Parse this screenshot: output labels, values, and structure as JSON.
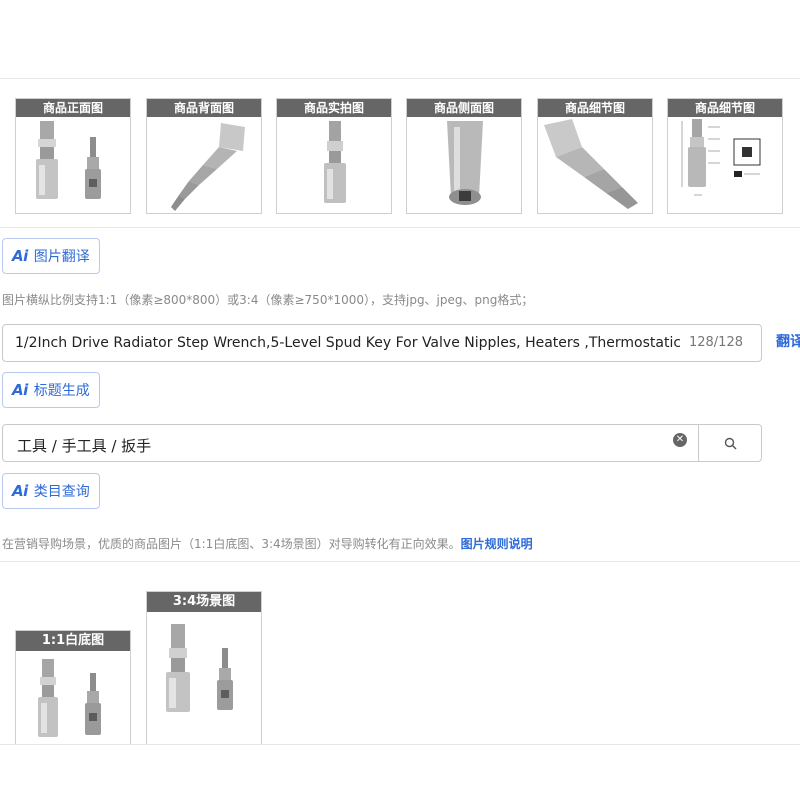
{
  "gallery": {
    "captions": [
      "商品正面图",
      "商品背面图",
      "商品实拍图",
      "商品侧面图",
      "商品细节图",
      "商品细节图"
    ]
  },
  "buttons": {
    "image_translate": "图片翻译",
    "title_generate": "标题生成",
    "category_query": "类目查询",
    "ai_icon_text": "Ai"
  },
  "image_hint": "图片横纵比例支持1:1（像素≥800*800）或3:4（像素≥750*1000），支持jpg、jpeg、png格式；",
  "title_field": {
    "value": "1/2Inch Drive Radiator Step Wrench,5-Level Spud Key For Valve Nipples, Heaters ,Thermostatic",
    "count": "128/128",
    "translate_label": "翻译"
  },
  "category_field": {
    "value": "工具 / 手工具 / 扳手"
  },
  "marketing": {
    "hint": "在营销导购场景，优质的商品图片（1:1白底图、3:4场景图）对导购转化有正向效果。",
    "rule_link": "图片规则说明"
  },
  "marketing_images": {
    "white_bg": "1:1白底图",
    "scene": "3:4场景图"
  },
  "colors": {
    "accent": "#2f6ad9",
    "caption_bg": "#666666",
    "border": "#c9c9c9"
  }
}
